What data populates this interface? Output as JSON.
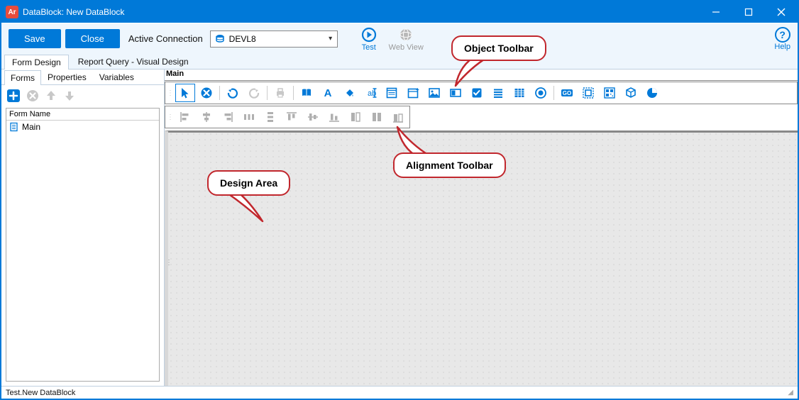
{
  "window": {
    "title": "DataBlock: New DataBlock",
    "app_icon_text": "Ar"
  },
  "toolbar": {
    "save_label": "Save",
    "close_label": "Close",
    "active_connection_label": "Active Connection",
    "connection_name": "DEVL8",
    "test_label": "Test",
    "webview_label": "Web View",
    "help_label": "Help"
  },
  "tabs": {
    "form_design": "Form Design",
    "report_query": "Report Query - Visual Design"
  },
  "subtabs": {
    "forms": "Forms",
    "properties": "Properties",
    "variables": "Variables"
  },
  "forms": {
    "header": "Form Name",
    "items": [
      {
        "label": "Main"
      }
    ]
  },
  "design": {
    "panel_title": "Main"
  },
  "object_toolbar_icons": [
    "pointer",
    "cancel",
    "undo",
    "redo",
    "print",
    "book",
    "text-a",
    "fill",
    "edit-field",
    "form",
    "date",
    "image",
    "panel",
    "checkbox",
    "list",
    "grid",
    "radio",
    "go",
    "group",
    "barcode",
    "cube",
    "pie"
  ],
  "alignment_toolbar_icons": [
    "align-left",
    "align-center-h",
    "align-right",
    "distribute-h",
    "distribute-v",
    "align-top",
    "align-middle",
    "align-bottom",
    "size-width",
    "size-height",
    "size-both"
  ],
  "callouts": {
    "object_toolbar": "Object Toolbar",
    "alignment_toolbar": "Alignment Toolbar",
    "design_area": "Design Area"
  },
  "status": {
    "text": "Test.New DataBlock"
  }
}
